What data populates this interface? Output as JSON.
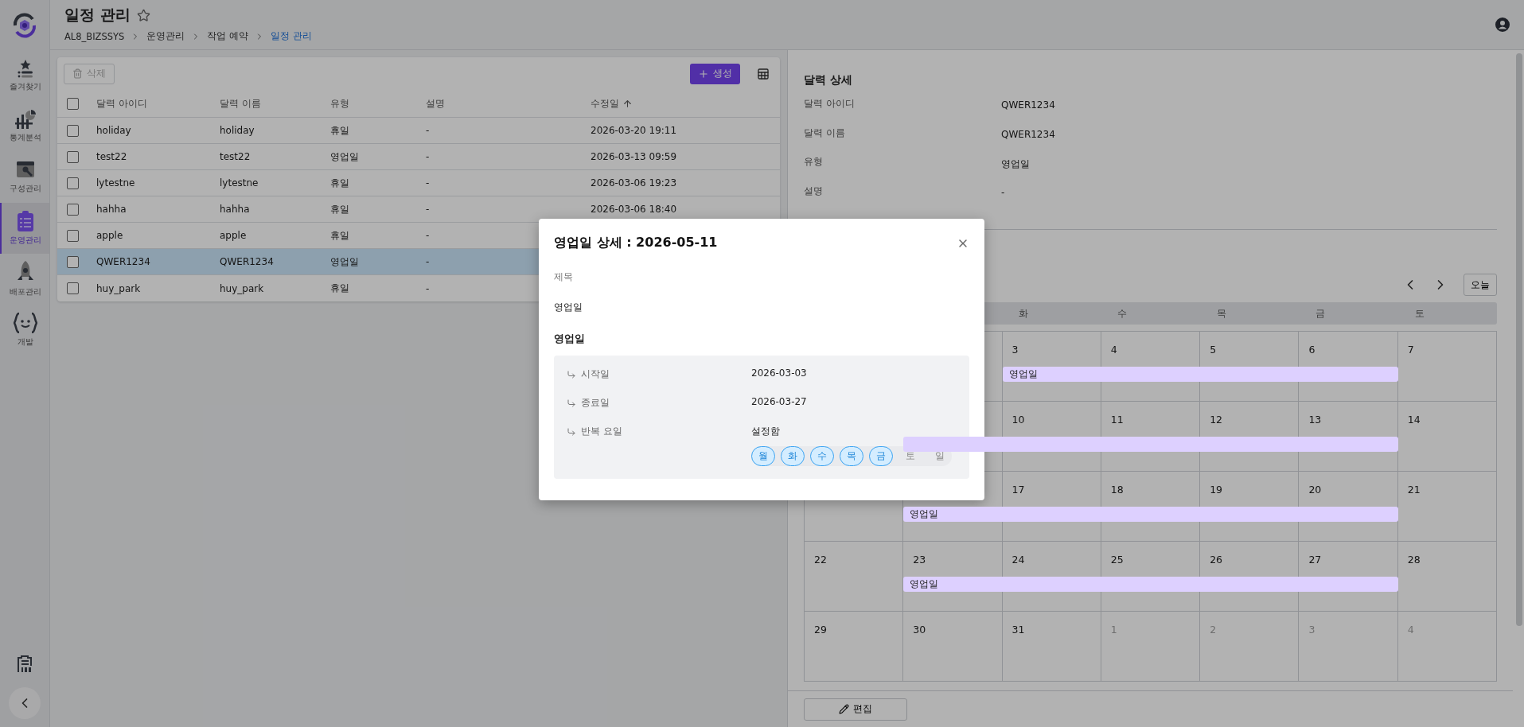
{
  "sidebar": {
    "items": [
      {
        "label": "즐겨찾기",
        "kind": "favorites",
        "selected": false
      },
      {
        "label": "통계분석",
        "kind": "stats",
        "selected": false
      },
      {
        "label": "구성관리",
        "kind": "config",
        "selected": false
      },
      {
        "label": "운영관리",
        "kind": "operations",
        "selected": true
      },
      {
        "label": "배포관리",
        "kind": "deploy",
        "selected": false
      },
      {
        "label": "개발",
        "kind": "dev",
        "selected": false
      }
    ]
  },
  "header": {
    "title": "일정 관리",
    "favorite": false,
    "breadcrumb": [
      {
        "label": "AL8_BIZSSYS",
        "current": false
      },
      {
        "label": "운영관리",
        "current": false
      },
      {
        "label": "작업 예약",
        "current": false
      },
      {
        "label": "일정 관리",
        "current": true
      }
    ]
  },
  "table": {
    "delete_label": "삭제",
    "delete_disabled": true,
    "create_label": "생성",
    "all_checked": false,
    "columns": [
      {
        "label": "달력 아이디",
        "sorted": false
      },
      {
        "label": "달력 이름",
        "sorted": false
      },
      {
        "label": "유형",
        "sorted": false
      },
      {
        "label": "설명",
        "sorted": false
      },
      {
        "label": "수정일",
        "sorted": true
      }
    ],
    "rows": [
      {
        "cells": [
          "holiday",
          "holiday",
          "휴일",
          "-",
          "2026-03-20 19:11"
        ],
        "checked": false,
        "selected": false
      },
      {
        "cells": [
          "test22",
          "test22",
          "영업일",
          "-",
          "2026-03-13 09:59"
        ],
        "checked": false,
        "selected": false
      },
      {
        "cells": [
          "lytestne",
          "lytestne",
          "휴일",
          "-",
          "2026-03-06 19:23"
        ],
        "checked": false,
        "selected": false
      },
      {
        "cells": [
          "hahha",
          "hahha",
          "휴일",
          "-",
          "2026-03-06 18:40"
        ],
        "checked": false,
        "selected": false
      },
      {
        "cells": [
          "apple",
          "apple",
          "휴일",
          "-"
        ],
        "checked": false,
        "selected": false
      },
      {
        "cells": [
          "QWER1234",
          "QWER1234",
          "영업일",
          "-"
        ],
        "checked": false,
        "selected": true
      },
      {
        "cells": [
          "huy_park",
          "huy_park",
          "휴일",
          "-"
        ],
        "checked": false,
        "selected": false
      }
    ]
  },
  "detail": {
    "title": "달력 상세",
    "fields": [
      {
        "label": "달력 아이디",
        "value": "QWER1234"
      },
      {
        "label": "달력 이름",
        "value": "QWER1234"
      },
      {
        "label": "유형",
        "value": "영업일"
      },
      {
        "label": "설명",
        "value": "-"
      }
    ]
  },
  "calendar": {
    "today_label": "오늘",
    "weekdays": [
      "화",
      "수",
      "목",
      "금",
      "토"
    ],
    "weeks": [
      {
        "event_label": "영업일",
        "days": [
          {
            "day": "3",
            "in_event": true,
            "muted": false
          },
          {
            "day": "4",
            "in_event": true,
            "muted": false
          },
          {
            "day": "5",
            "in_event": true,
            "muted": false
          },
          {
            "day": "6",
            "in_event": true,
            "muted": false
          },
          {
            "day": "7",
            "in_event": false,
            "muted": false
          }
        ]
      },
      {
        "days": [
          {
            "in_event": true
          },
          {
            "day": "10",
            "in_event": true,
            "muted": false
          },
          {
            "day": "11",
            "in_event": true,
            "muted": false
          },
          {
            "day": "12",
            "in_event": true,
            "muted": false
          },
          {
            "day": "13",
            "in_event": true,
            "muted": false
          },
          {
            "day": "14",
            "in_event": false,
            "muted": false
          }
        ]
      },
      {
        "event_label": "영업일",
        "days": [
          {
            "in_event": true
          },
          {
            "day": "17",
            "in_event": true,
            "muted": false
          },
          {
            "day": "18",
            "in_event": true,
            "muted": false
          },
          {
            "day": "19",
            "in_event": true,
            "muted": false
          },
          {
            "day": "20",
            "in_event": true,
            "muted": false
          },
          {
            "day": "21",
            "in_event": false,
            "muted": false
          }
        ]
      },
      {
        "event_label": "영업일",
        "days": [
          {
            "day": "22",
            "in_event": false,
            "muted": false
          },
          {
            "day": "23",
            "in_event": true,
            "muted": false
          },
          {
            "day": "24",
            "in_event": true,
            "muted": false
          },
          {
            "day": "25",
            "in_event": true,
            "muted": false
          },
          {
            "day": "26",
            "in_event": true,
            "muted": false
          },
          {
            "day": "27",
            "in_event": true,
            "muted": false
          },
          {
            "day": "28",
            "in_event": false,
            "muted": false
          }
        ]
      },
      {
        "days": [
          {
            "day": "29",
            "in_event": false,
            "muted": false
          },
          {
            "day": "30",
            "in_event": false,
            "muted": false
          },
          {
            "day": "31",
            "in_event": false,
            "muted": false
          },
          {
            "day": "1",
            "in_event": false,
            "muted": true
          },
          {
            "day": "2",
            "in_event": false,
            "muted": true
          },
          {
            "day": "3",
            "in_event": false,
            "muted": true
          },
          {
            "day": "4",
            "in_event": false,
            "muted": true
          }
        ]
      }
    ]
  },
  "edit_label": "편집",
  "modal": {
    "title": "영업일 상세 : 2026-05-11",
    "field_label": "제목",
    "field_value": "영업일",
    "section_title": "영업일",
    "rows": [
      {
        "label": "시작일",
        "value": "2026-03-03"
      },
      {
        "label": "종료일",
        "value": "2026-03-27"
      },
      {
        "label": "반복 요일",
        "value": "설정함",
        "days": [
          {
            "label": "월",
            "selected": true
          },
          {
            "label": "화",
            "selected": true
          },
          {
            "label": "수",
            "selected": true
          },
          {
            "label": "목",
            "selected": true
          },
          {
            "label": "금",
            "selected": true
          },
          {
            "label": "토",
            "selected": false
          },
          {
            "label": "일",
            "selected": false
          }
        ]
      }
    ]
  }
}
